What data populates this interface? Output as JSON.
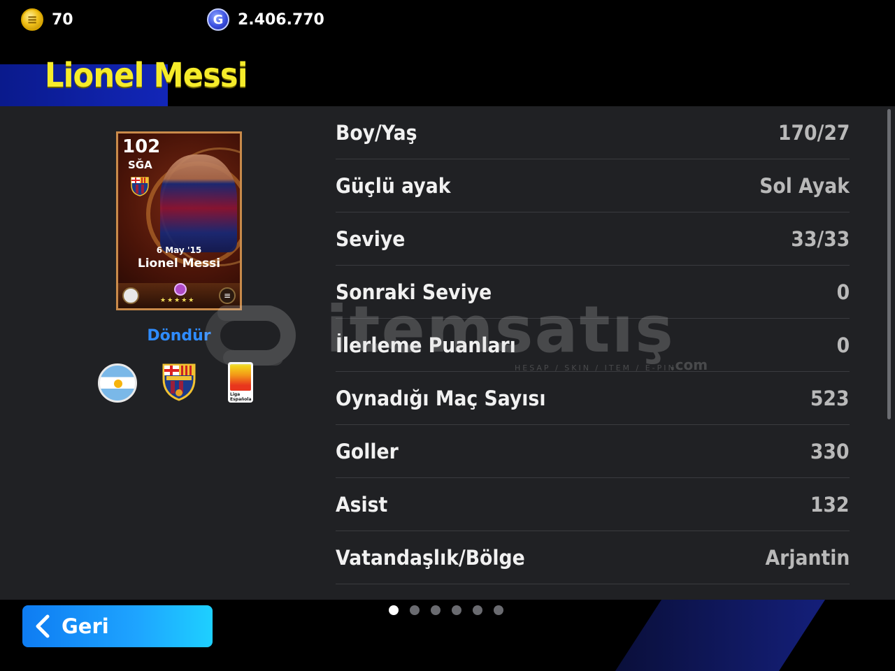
{
  "header": {
    "coins": "70",
    "gp": "2.406.770",
    "player_name": "Lionel Messi"
  },
  "card": {
    "rating": "102",
    "position": "SĞA",
    "date": "6 May '15",
    "name": "Lionel Messi",
    "stars": "★★★★★"
  },
  "rotate_label": "Döndür",
  "badges": [
    "argentina-flag-icon",
    "fc-barcelona-crest-icon",
    "liga-espanola-logo-icon"
  ],
  "liga_text": "Liga Española",
  "stats": [
    {
      "label": "Boy/Yaş",
      "value": "170/27"
    },
    {
      "label": "Güçlü ayak",
      "value": "Sol Ayak"
    },
    {
      "label": "Seviye",
      "value": "33/33"
    },
    {
      "label": "Sonraki Seviye",
      "value": "0"
    },
    {
      "label": "İlerleme Puanları",
      "value": "0"
    },
    {
      "label": "Oynadığı Maç Sayısı",
      "value": "523"
    },
    {
      "label": "Goller",
      "value": "330"
    },
    {
      "label": "Asist",
      "value": "132"
    },
    {
      "label": "Vatandaşlık/Bölge",
      "value": "Arjantin"
    }
  ],
  "watermark": {
    "text": "itemsatış",
    "sub": "HESAP / SKIN / ITEM / E-PIN",
    "com": ".com"
  },
  "footer": {
    "back_label": "Geri",
    "page_count": 6,
    "active_page": 1
  },
  "colors": {
    "name_yellow": "#f6ec2a",
    "accent_blue": "#2f8cff",
    "panel_bg": "#202124"
  }
}
